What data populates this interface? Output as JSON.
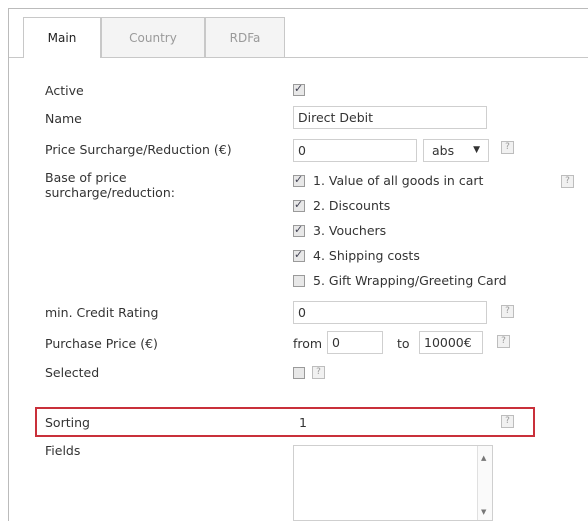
{
  "tabs": [
    {
      "label": "Main"
    },
    {
      "label": "Country"
    },
    {
      "label": "RDFa"
    }
  ],
  "fields": {
    "active": {
      "label": "Active",
      "checked": true
    },
    "name": {
      "label": "Name",
      "value": "Direct Debit"
    },
    "price": {
      "label": "Price Surcharge/Reduction (€)",
      "value": "0",
      "unit": "abs"
    },
    "base": {
      "label_line1": "Base of price",
      "label_line2": "surcharge/reduction:",
      "options": [
        {
          "label": "1. Value of all goods in cart",
          "checked": true
        },
        {
          "label": "2. Discounts",
          "checked": true
        },
        {
          "label": "3. Vouchers",
          "checked": true
        },
        {
          "label": "4. Shipping costs",
          "checked": true
        },
        {
          "label": "5. Gift Wrapping/Greeting Card",
          "checked": false
        }
      ]
    },
    "credit": {
      "label": "min. Credit Rating",
      "value": "0"
    },
    "purchase": {
      "label": "Purchase Price (€)",
      "from_label": "from",
      "from_value": "0",
      "to_label": "to",
      "to_value": "10000€"
    },
    "selected": {
      "label": "Selected",
      "checked": false
    },
    "sorting": {
      "label": "Sorting",
      "value": "1"
    },
    "fieldsbox": {
      "label": "Fields",
      "value": ""
    }
  },
  "help_glyph": "?",
  "colors": {
    "highlight": "#c9303a",
    "border": "#cfcfcf"
  }
}
